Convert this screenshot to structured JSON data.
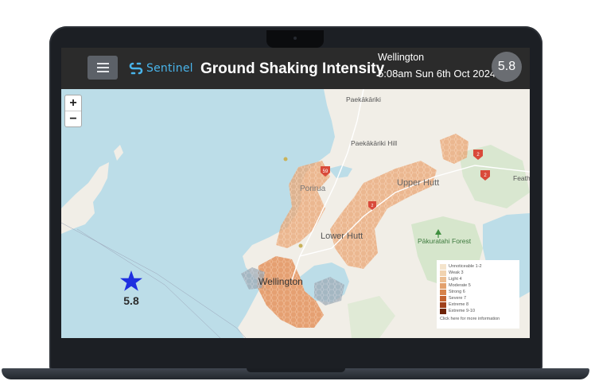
{
  "header": {
    "brand_name": "Sentinel",
    "title": "Ground Shaking Intensity",
    "location": "Wellington",
    "datetime": "5:08am Sun 6th Oct 2024",
    "magnitude": "5.8"
  },
  "map": {
    "zoom_in": "+",
    "zoom_out": "−",
    "labels": {
      "paekakariki": "Paekākāriki",
      "paekakariki_hill": "Paekākāriki Hill",
      "porirua": "Porirua",
      "upper_hutt": "Upper Hutt",
      "lower_hutt": "Lower Hutt",
      "pakuratahi_forest": "Pākuratahi Forest",
      "wellington": "Wellington",
      "featherston": "Feath"
    },
    "route_shields": [
      "59",
      "2",
      "2",
      "2"
    ],
    "epicentre_magnitude": "5.8"
  },
  "legend": {
    "items": [
      {
        "label": "Unnoticeable 1-2",
        "color": "#f4e4cc"
      },
      {
        "label": "Weak 3",
        "color": "#f1d3b0"
      },
      {
        "label": "Light 4",
        "color": "#ecbe92"
      },
      {
        "label": "Moderate 5",
        "color": "#e3a06c"
      },
      {
        "label": "Strong 6",
        "color": "#d7824a"
      },
      {
        "label": "Severe 7",
        "color": "#c4622f"
      },
      {
        "label": "Extreme 8",
        "color": "#a0401b"
      },
      {
        "label": "Extreme 9-10",
        "color": "#6e2408"
      }
    ],
    "note": "Click here for more information"
  },
  "colors": {
    "header_bg": "#2b2b2b",
    "brand": "#49b4ea",
    "water": "#bcdde8",
    "land": "#f1eee7",
    "shaking": "#e3a06c",
    "epicentre": "#1f2fe0"
  }
}
